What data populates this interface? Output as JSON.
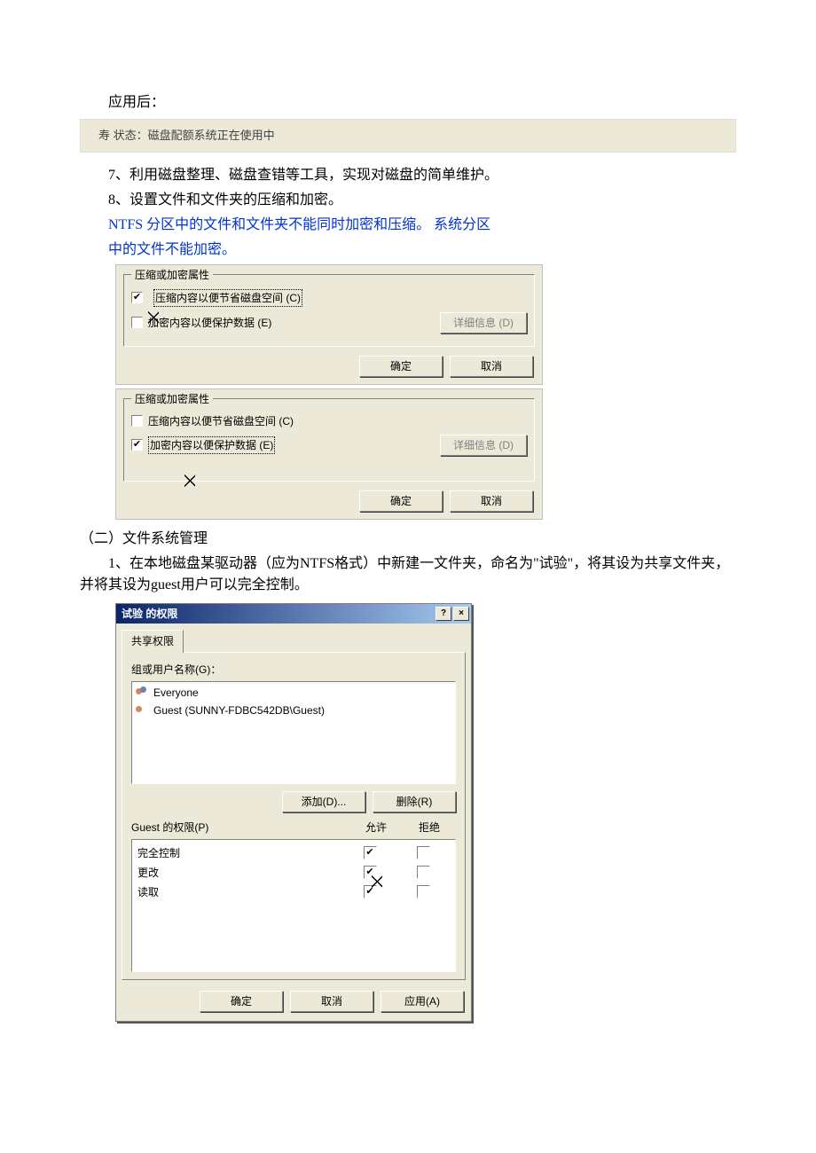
{
  "text": {
    "after_apply": "应用后：",
    "status_line": "寿  状态：磁盘配额系统正在使用中",
    "item7": "7、利用磁盘整理、磁盘查错等工具，实现对磁盘的简单维护。",
    "item8": "8、设置文件和文件夹的压缩和加密。",
    "ntfs_note_a": "NTFS 分区中的文件和文件夹不能同时加密和压缩。   系统分区",
    "ntfs_note_b": "中的文件不能加密。",
    "section2_title": "（二）文件系统管理",
    "section2_item1": "1、在本地磁盘某驱动器（应为NTFS格式）中新建一文件夹，命名为\"试验\"，将其设为共享文件夹，并将其设为guest用户可以完全控制。"
  },
  "group1": {
    "legend": "压缩或加密属性",
    "compress": {
      "label": "压缩内容以便节省磁盘空间 (C)",
      "checked": true,
      "focused": true
    },
    "encrypt": {
      "label": "加密内容以便保护数据 (E)",
      "checked": false,
      "focused": false
    },
    "details": "详细信息 (D)",
    "ok": "确定",
    "cancel": "取消"
  },
  "group2": {
    "legend": "压缩或加密属性",
    "compress": {
      "label": "压缩内容以便节省磁盘空间 (C)",
      "checked": false,
      "focused": false
    },
    "encrypt": {
      "label": "加密内容以便保护数据 (E)",
      "checked": true,
      "focused": true
    },
    "details": "详细信息 (D)",
    "ok": "确定",
    "cancel": "取消"
  },
  "perm": {
    "title": "试验 的权限",
    "help_btn": "?",
    "close_btn": "×",
    "tab": "共享权限",
    "group_label": "组或用户名称(G)：",
    "users": [
      {
        "name": "Everyone",
        "multi": true
      },
      {
        "name": "Guest (SUNNY-FDBC542DB\\Guest)",
        "multi": false
      }
    ],
    "add_btn": "添加(D)...",
    "remove_btn": "删除(R)",
    "perm_for": "Guest 的权限(P)",
    "col_allow": "允许",
    "col_deny": "拒绝",
    "rows": [
      {
        "name": "完全控制",
        "allow": true,
        "deny": false
      },
      {
        "name": "更改",
        "allow": true,
        "deny": false
      },
      {
        "name": "读取",
        "allow": true,
        "deny": false
      }
    ],
    "ok": "确定",
    "cancel": "取消",
    "apply": "应用(A)"
  }
}
